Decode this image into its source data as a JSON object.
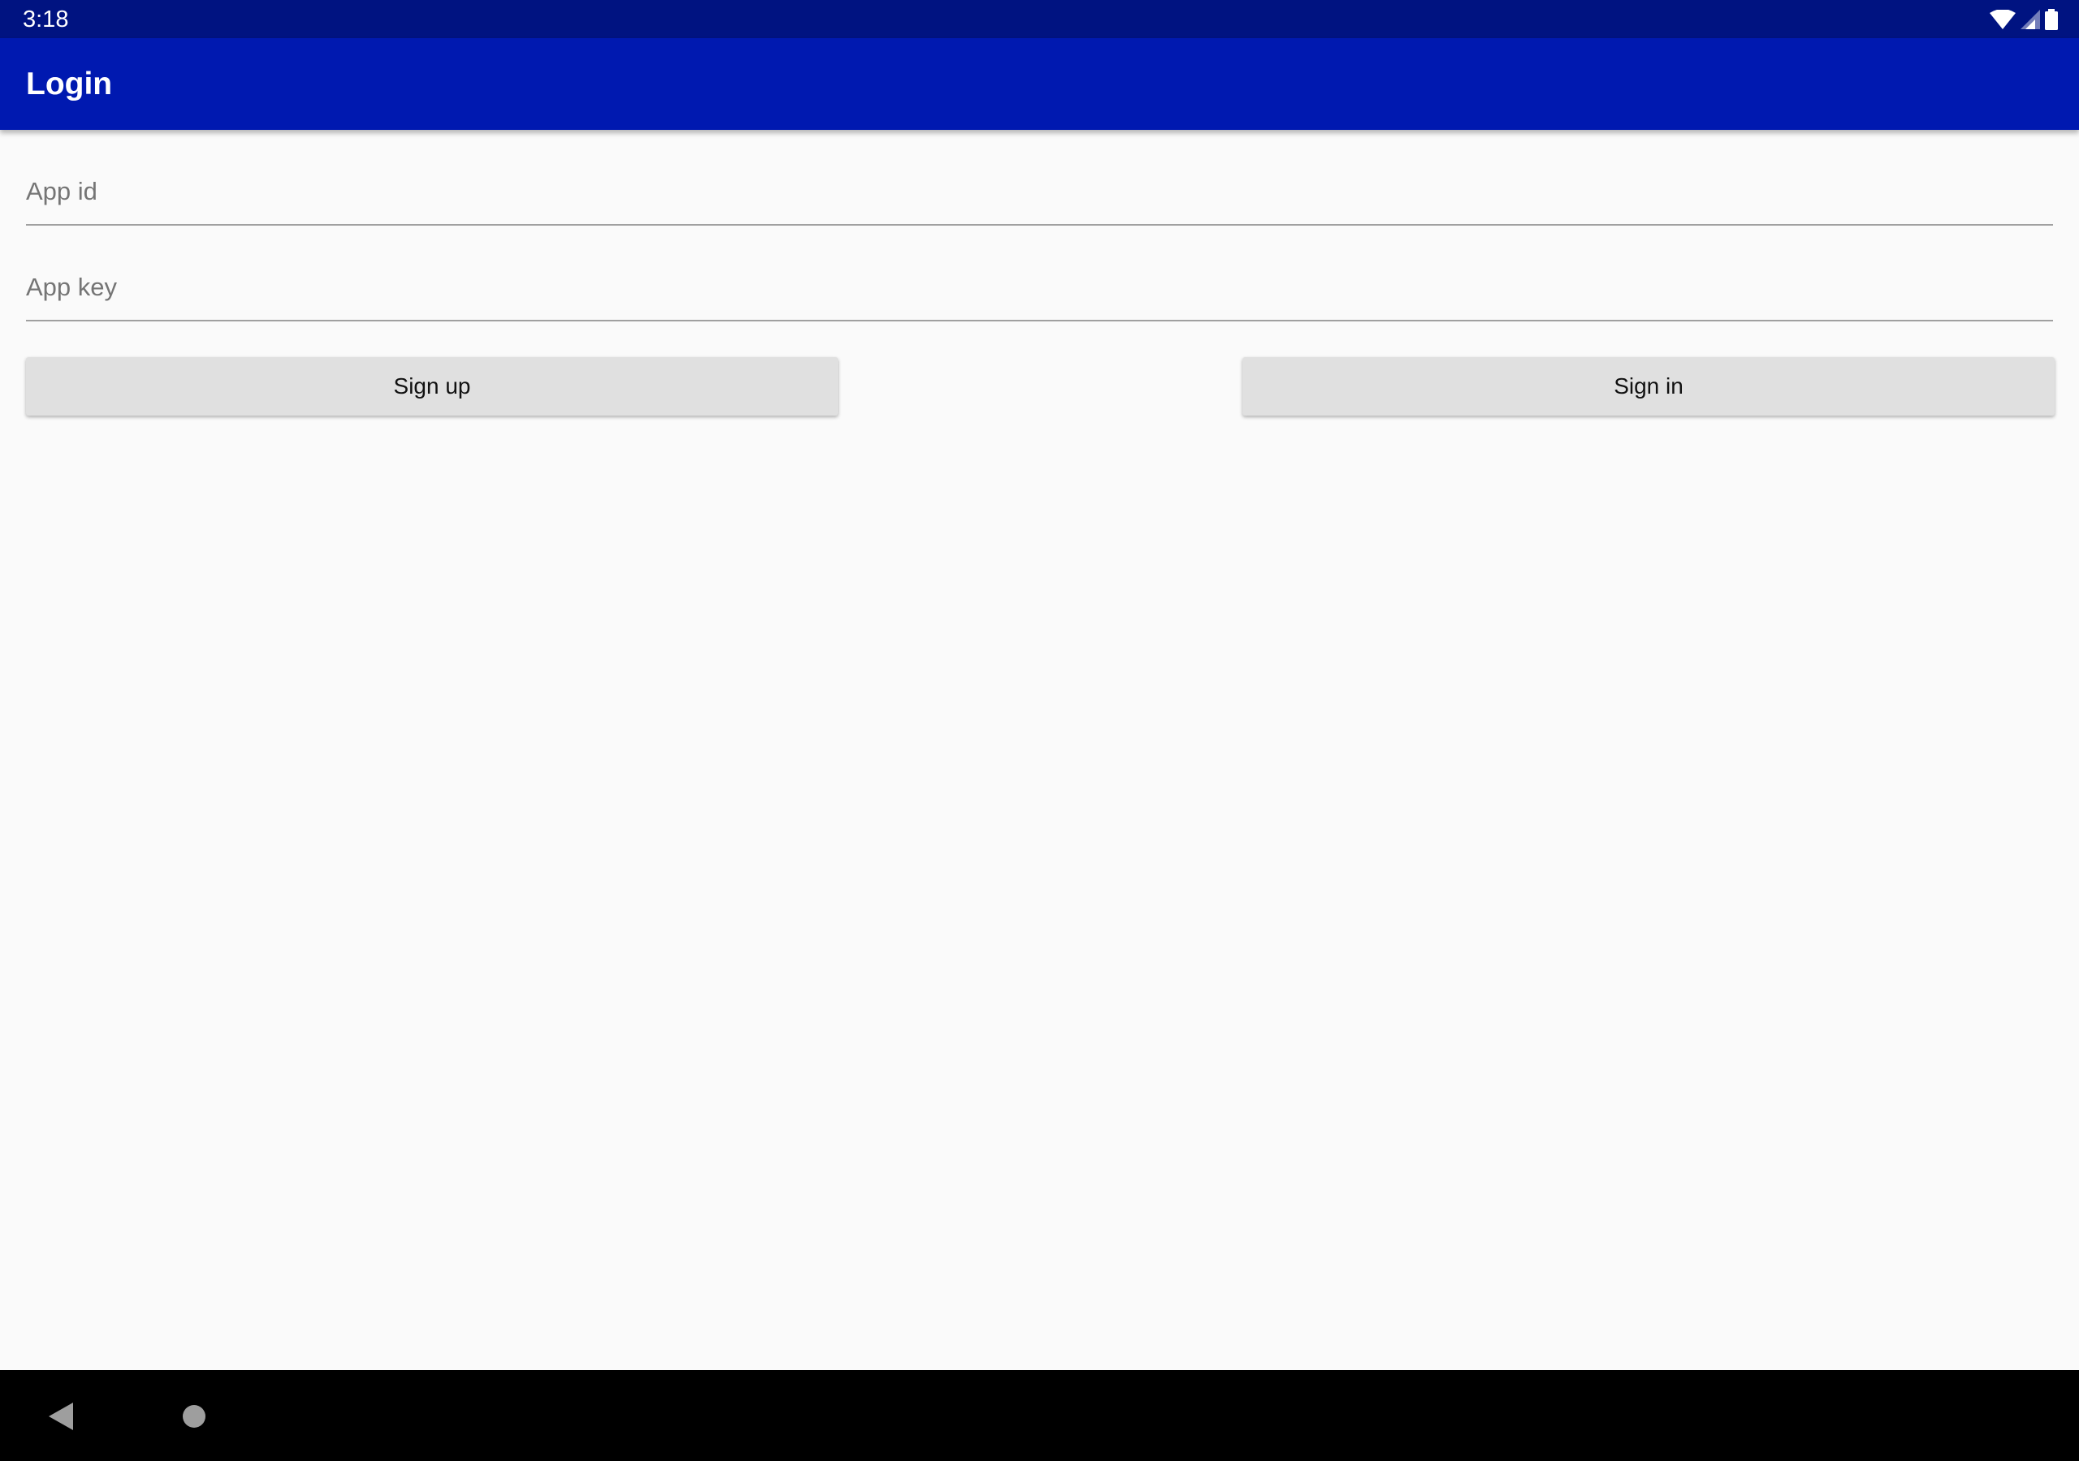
{
  "status_bar": {
    "time": "3:18",
    "icons": [
      "wifi-icon",
      "signal-icon",
      "battery-icon"
    ],
    "background": "#001381"
  },
  "app_bar": {
    "title": "Login",
    "background": "#0019b0"
  },
  "form": {
    "app_id": {
      "placeholder": "App id",
      "value": ""
    },
    "app_key": {
      "placeholder": "App key",
      "value": ""
    }
  },
  "buttons": {
    "sign_up": "Sign up",
    "sign_in": "Sign in"
  },
  "nav_bar": {
    "icons": [
      "back-icon",
      "home-icon"
    ]
  }
}
